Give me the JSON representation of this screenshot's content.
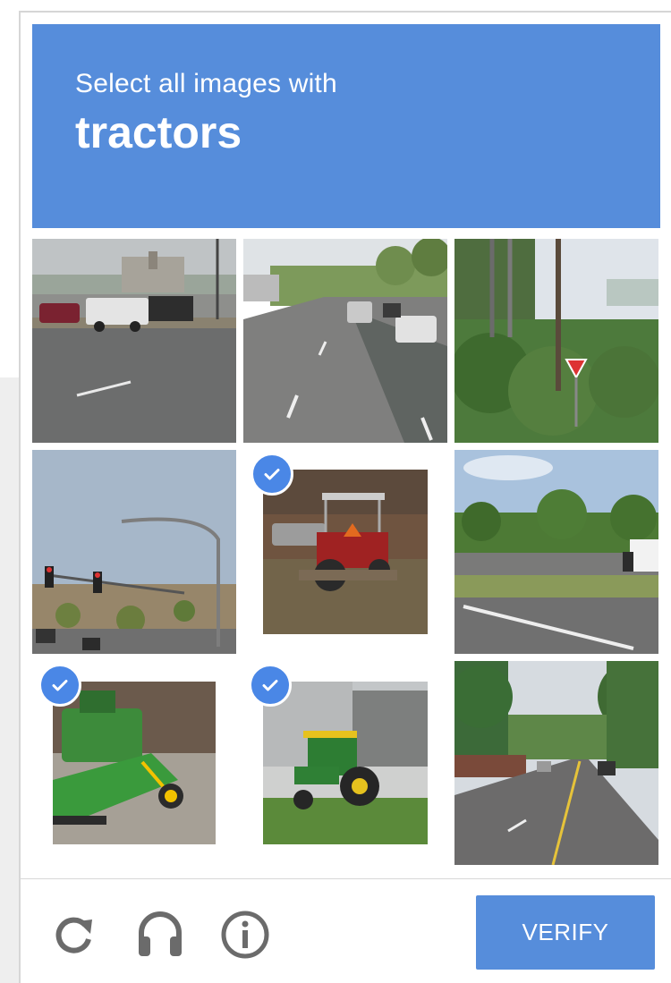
{
  "challenge": {
    "prompt": "Select all images with",
    "keyword": "tractors"
  },
  "tiles": [
    {
      "name": "tile-1",
      "content": "street with pickup trucks",
      "selected": false
    },
    {
      "name": "tile-2",
      "content": "road with cars",
      "selected": false
    },
    {
      "name": "tile-3",
      "content": "trees and yield sign",
      "selected": false
    },
    {
      "name": "tile-4",
      "content": "traffic light and hillside",
      "selected": false
    },
    {
      "name": "tile-5",
      "content": "red tractor",
      "selected": true
    },
    {
      "name": "tile-6",
      "content": "highway with truck",
      "selected": false
    },
    {
      "name": "tile-7",
      "content": "green harvester",
      "selected": true
    },
    {
      "name": "tile-8",
      "content": "green tractor by building",
      "selected": true
    },
    {
      "name": "tile-9",
      "content": "tree-lined road",
      "selected": false
    }
  ],
  "footer": {
    "reload_icon": "reload-icon",
    "audio_icon": "headphones-icon",
    "info_icon": "info-icon",
    "verify_label": "VERIFY"
  },
  "colors": {
    "accent": "#568ddb",
    "check": "#4a87e6"
  }
}
